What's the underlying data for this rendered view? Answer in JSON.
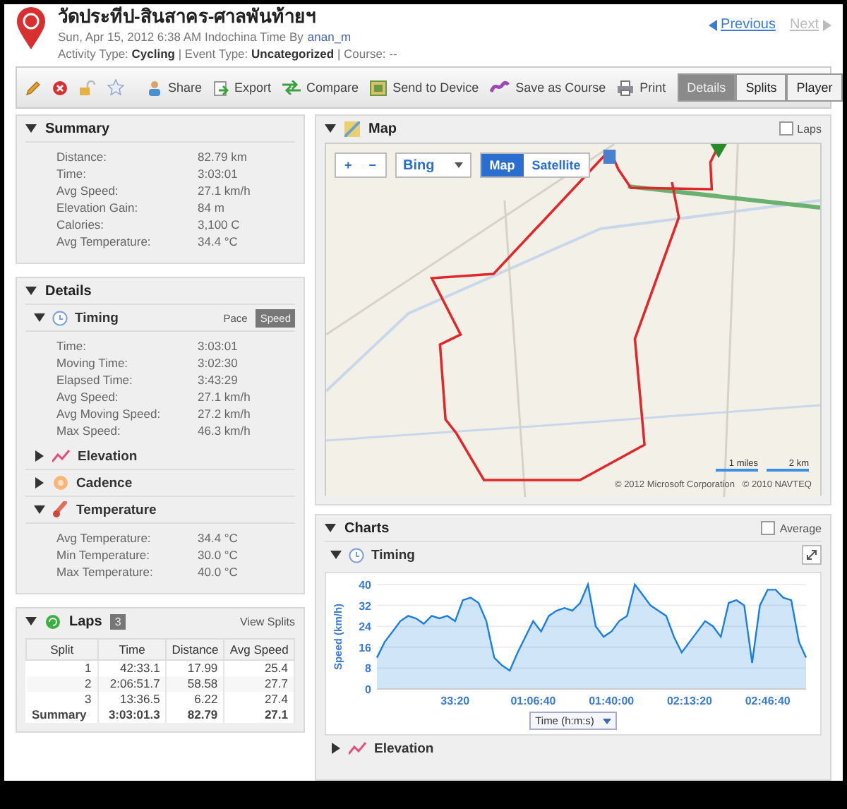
{
  "header": {
    "title": "วัดประทีป-สินสาคร-ศาลพันท้ายฯ",
    "date_line": "Sun, Apr 15, 2012 6:38 AM Indochina Time By",
    "author": "anan_m",
    "info_line": "Activity Type: **Cycling** | Event Type: **Uncategorized** | Course: --",
    "nav": [
      {
        "label": "Previous",
        "disabled": false
      },
      {
        "label": "Next",
        "disabled": true
      }
    ]
  },
  "toolbar": {
    "actions": [
      {
        "kind": "share",
        "label": "Share"
      },
      {
        "kind": "export",
        "label": "Export"
      },
      {
        "kind": "compare",
        "label": "Compare"
      },
      {
        "kind": "send",
        "label": "Send to Device"
      },
      {
        "kind": "course",
        "label": "Save as Course"
      },
      {
        "kind": "print",
        "label": "Print"
      }
    ],
    "views": [
      {
        "label": "Details",
        "selected": true
      },
      {
        "label": "Splits",
        "selected": false
      },
      {
        "label": "Player",
        "selected": false
      }
    ]
  },
  "summary": {
    "title": "Summary",
    "rows": [
      {
        "label": "Distance:",
        "value": "82.79 km"
      },
      {
        "label": "Time:",
        "value": "3:03:01"
      },
      {
        "label": "Avg Speed:",
        "value": "27.1 km/h"
      },
      {
        "label": "Elevation Gain:",
        "value": "84 m"
      },
      {
        "label": "Calories:",
        "value": "3,100 C"
      },
      {
        "label": "Avg Temperature:",
        "value": "34.4 °C"
      }
    ]
  },
  "details": {
    "title": "Details",
    "sections": [
      {
        "kind": "timing",
        "title": "Timing",
        "expanded": true,
        "toggle": [
          {
            "label": "Pace",
            "selected": false
          },
          {
            "label": "Speed",
            "selected": true
          }
        ],
        "rows": [
          {
            "label": "Time:",
            "value": "3:03:01"
          },
          {
            "label": "Moving Time:",
            "value": "3:02:30"
          },
          {
            "label": "Elapsed Time:",
            "value": "3:43:29"
          },
          {
            "label": "Avg Speed:",
            "value": "27.1 km/h"
          },
          {
            "label": "Avg Moving Speed:",
            "value": "27.2 km/h"
          },
          {
            "label": "Max Speed:",
            "value": "46.3 km/h"
          }
        ]
      },
      {
        "kind": "elevation",
        "title": "Elevation",
        "expanded": false
      },
      {
        "kind": "cadence",
        "title": "Cadence",
        "expanded": false
      },
      {
        "kind": "temperature",
        "title": "Temperature",
        "expanded": true,
        "rows": [
          {
            "label": "Avg Temperature:",
            "value": "34.4 °C"
          },
          {
            "label": "Min Temperature:",
            "value": "30.0 °C"
          },
          {
            "label": "Max Temperature:",
            "value": "40.0 °C"
          }
        ]
      }
    ]
  },
  "laps": {
    "title": "Laps",
    "count": "3",
    "link": "View Splits",
    "columns": [
      "Split",
      "Time",
      "Distance",
      "Avg Speed"
    ],
    "rows": [
      [
        "1",
        "42:33.1",
        "17.99",
        "25.4"
      ],
      [
        "2",
        "2:06:51.7",
        "58.58",
        "27.7"
      ],
      [
        "3",
        "13:36.5",
        "6.22",
        "27.4"
      ]
    ],
    "summary": [
      "Summary",
      "3:03:01.3",
      "82.79",
      "27.1"
    ]
  },
  "map": {
    "title": "Map",
    "laps_checkbox": {
      "label": "Laps",
      "checked": false
    },
    "zoom_in": "+",
    "zoom_out": "−",
    "provider": "Bing",
    "modes": [
      {
        "label": "Map",
        "selected": true
      },
      {
        "label": "Satellite",
        "selected": false
      }
    ],
    "scale": [
      "1 miles",
      "2 km"
    ],
    "copyright": "© 2012 Microsoft Corporation   © 2010 NAVTEQ"
  },
  "charts": {
    "title": "Charts",
    "average_checkbox": {
      "label": "Average",
      "checked": false
    },
    "sections": [
      {
        "title": "Timing",
        "expanded": true,
        "kind": "timing",
        "chart_data": {
          "type": "area",
          "ylabel": "Speed (km/h)",
          "xlabel": "Time (h:m:s)",
          "grid": true,
          "xlim": [
            0,
            10981
          ],
          "x": [
            0,
            200,
            400,
            600,
            800,
            1000,
            1200,
            1400,
            1600,
            1800,
            2000,
            2200,
            2400,
            2600,
            2800,
            3000,
            3200,
            3400,
            3600,
            3800,
            4000,
            4200,
            4400,
            4600,
            4800,
            5000,
            5200,
            5400,
            5600,
            5800,
            6000,
            6200,
            6400,
            6600,
            6800,
            7000,
            7200,
            7400,
            7600,
            7800,
            8000,
            8200,
            8400,
            8600,
            8800,
            9000,
            9200,
            9400,
            9600,
            9800,
            10000,
            10200,
            10400,
            10600,
            10800,
            10981
          ],
          "series": [
            {
              "color": "#1a7fe0",
              "values": [
                12,
                18,
                22,
                26,
                28,
                27,
                25,
                28,
                27,
                28,
                26,
                34,
                35,
                33,
                26,
                12,
                9,
                7,
                14,
                20,
                26,
                22,
                28,
                30,
                31,
                30,
                33,
                40,
                24,
                20,
                22,
                26,
                28,
                40,
                36,
                32,
                30,
                28,
                20,
                14,
                18,
                22,
                26,
                24,
                20,
                33,
                34,
                32,
                10,
                32,
                38,
                38,
                35,
                34,
                18,
                12
              ]
            }
          ],
          "ylim": [
            0,
            40
          ],
          "yticks": [
            0,
            8,
            16,
            24,
            32,
            40
          ],
          "xticks": [
            {
              "value": 2000,
              "label": "33:20"
            },
            {
              "value": 4000,
              "label": "01:06:40"
            },
            {
              "value": 6000,
              "label": "01:40:00"
            },
            {
              "value": 8000,
              "label": "02:13:20"
            },
            {
              "value": 10000,
              "label": "02:46:40"
            }
          ]
        }
      },
      {
        "title": "Elevation",
        "expanded": false,
        "kind": "elevation"
      }
    ]
  }
}
